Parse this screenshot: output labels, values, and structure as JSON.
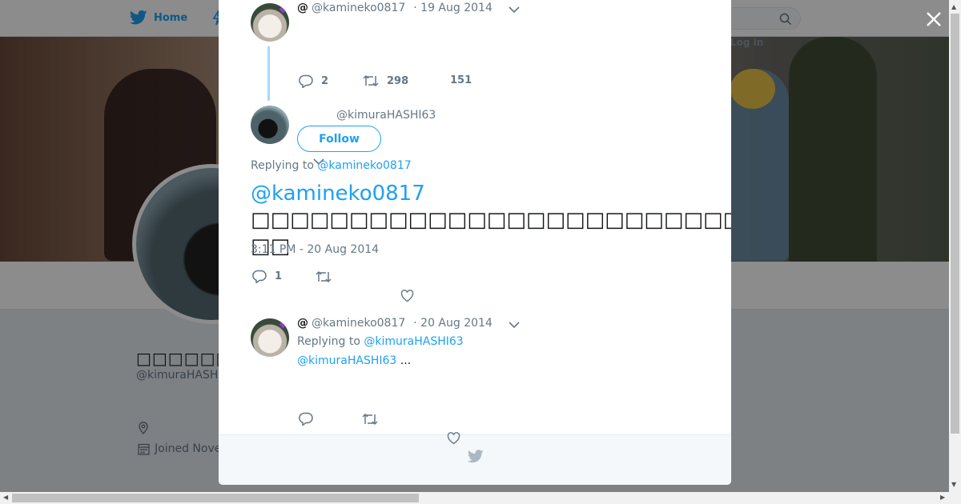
{
  "background": {
    "nav": {
      "home_label": "Home",
      "login_label": "Log in"
    },
    "profile": {
      "name": "□□□□□□□□",
      "handle": "@kimuraHASH",
      "joined": "Joined Nove"
    }
  },
  "modal": {
    "parent_tweet": {
      "at_symbol": "@",
      "handle": "@kamineko0817",
      "date": "· 19 Aug 2014",
      "stats": {
        "replies": "2",
        "retweets": "298",
        "likes": "151"
      }
    },
    "main_tweet": {
      "handle": "@kimuraHASHI63",
      "follow_label": "Follow",
      "replying_prefix": "Replying to",
      "replying_handle": "@kamineko0817",
      "text_mention": "@kamineko0817",
      "text_body_line1": "□□□□□□□□□□□□□□□□□□□□□□□□□□□□□□□□□□□□□",
      "text_body_line2": "□□",
      "timestamp": "3:11 PM - 20 Aug 2014",
      "stats": {
        "replies": "1"
      }
    },
    "reply_tweet": {
      "at_symbol": "@",
      "handle": "@kamineko0817",
      "date": "· 20 Aug 2014",
      "replying_prefix": "Replying to",
      "replying_handle": "@kimuraHASHI63",
      "text_mention": "@kimuraHASHI63",
      "text_ellipsis": "..."
    }
  },
  "colors": {
    "accent": "#1da1f2",
    "thread_line": "#a7d9fa",
    "muted": "#657786",
    "text": "#14171a"
  },
  "icons": [
    "twitter-bird-icon",
    "search-icon",
    "close-icon",
    "reply-icon",
    "retweet-icon",
    "heart-icon",
    "chevron-down-icon",
    "location-icon",
    "calendar-icon"
  ]
}
